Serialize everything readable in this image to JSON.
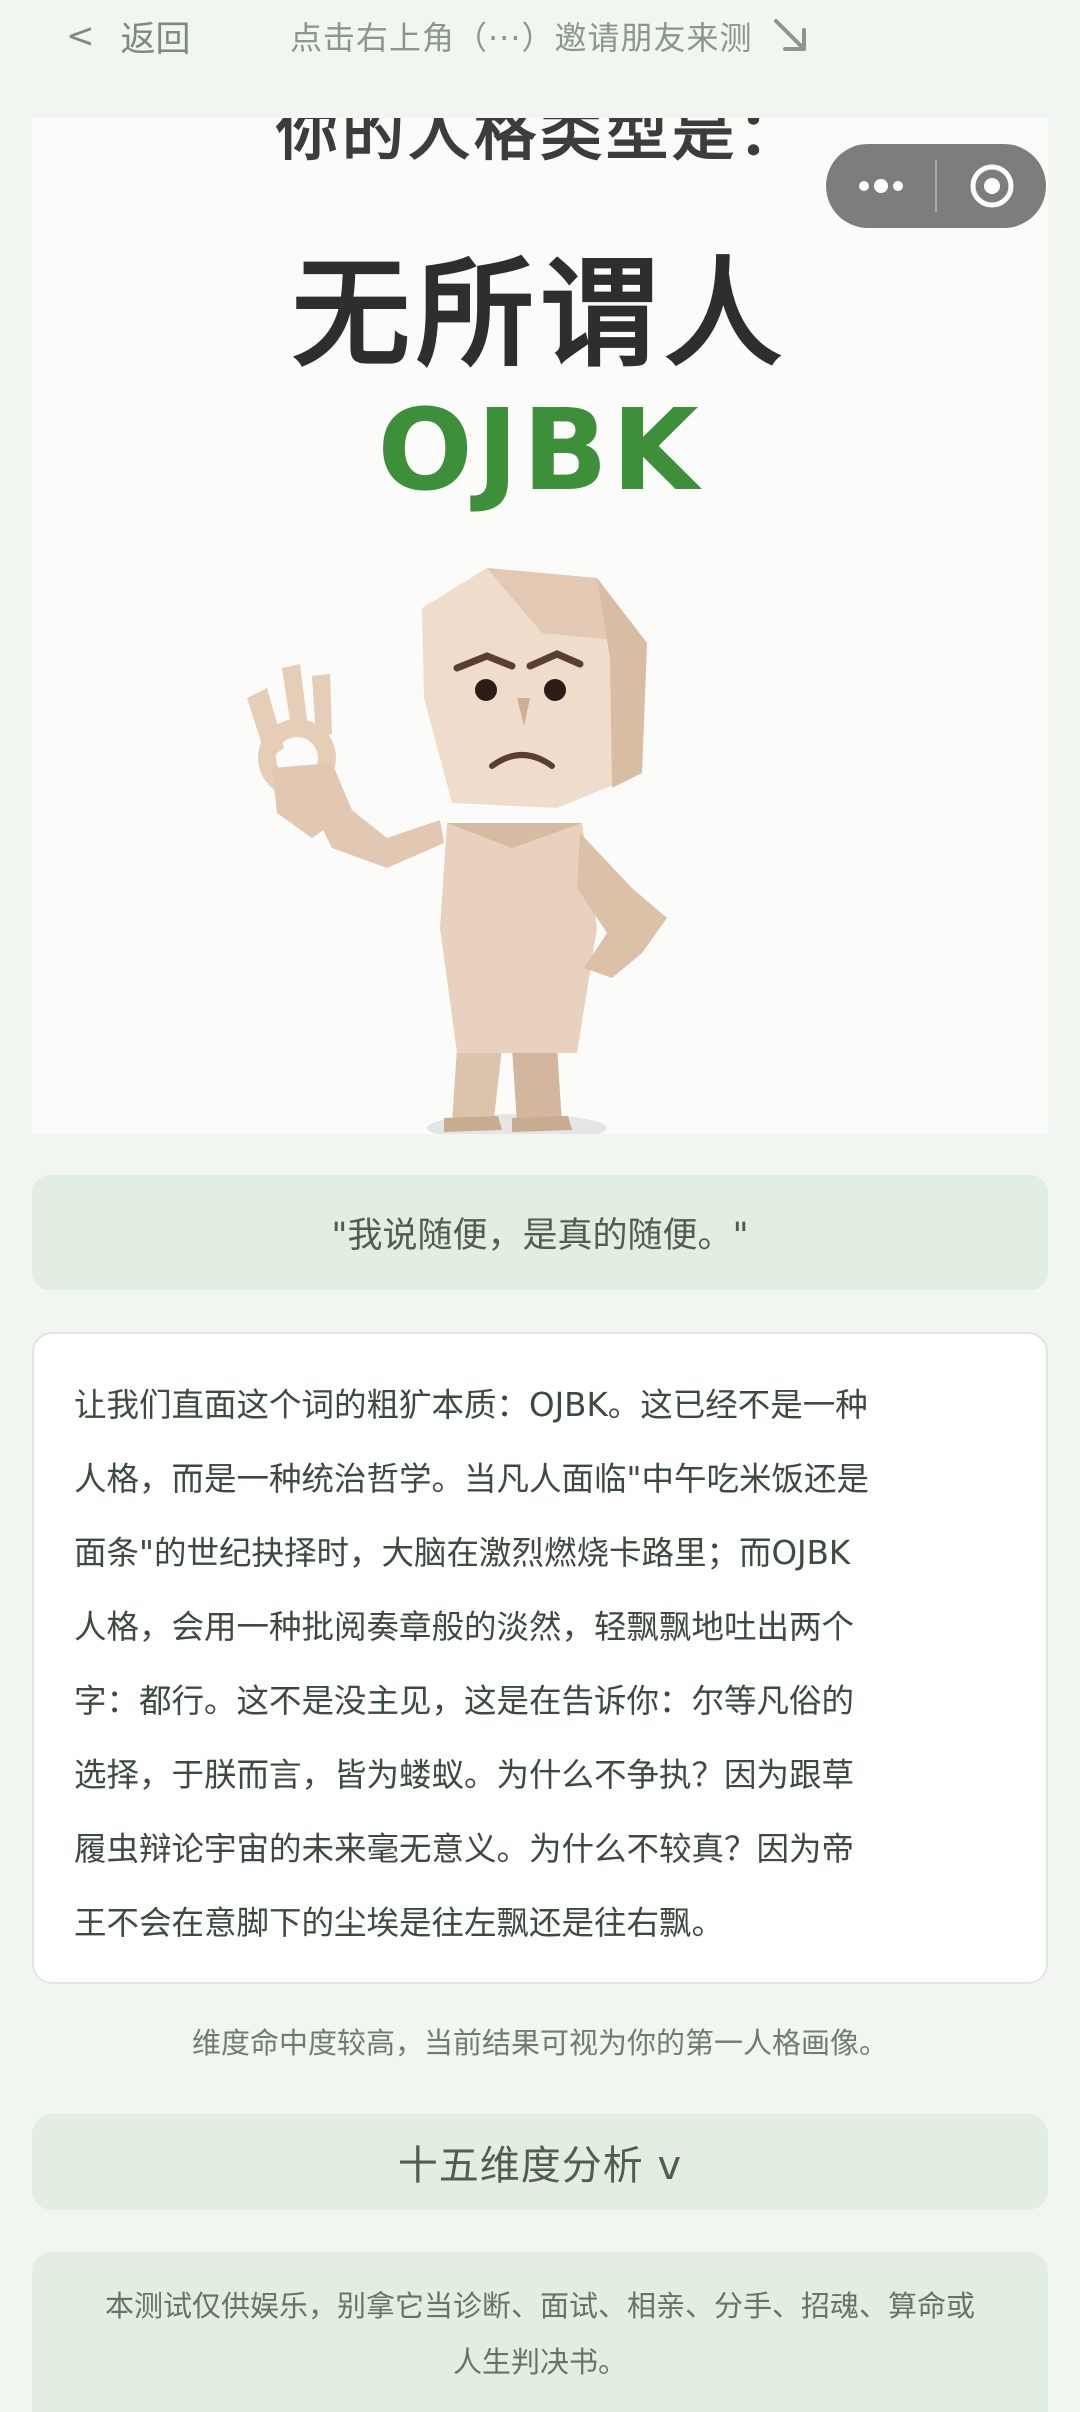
{
  "topbar": {
    "back_chevron": "<",
    "back_label": "返回",
    "hint": "点击右上角（···）邀请朋友来测",
    "hint_arrow_icon": "arrow-down-right-icon"
  },
  "hero": {
    "cut_title": "你的人格类型是：",
    "type_name": "无所谓人",
    "type_code": "OJBK"
  },
  "capsule": {
    "more_icon": "more-dots-icon",
    "close_icon": "target-circle-icon"
  },
  "quote": "\"我说随便，是真的随便。\"",
  "description_lines": [
    "让我们直面这个词的粗犷本质：OJBK。这已经不是一种",
    "人格，而是一种统治哲学。当凡人面临\"中午吃米饭还是",
    "面条\"的世纪抉择时，大脑在激烈燃烧卡路里；而OJBK",
    "人格，会用一种批阅奏章般的淡然，轻飘飘地吐出两个",
    "字：都行。这不是没主见，这是在告诉你：尔等凡俗的",
    "选择，于朕而言，皆为蝼蚁。为什么不争执？因为跟草",
    "履虫辩论宇宙的未来毫无意义。为什么不较真？因为帝",
    "王不会在意脚下的尘埃是往左飘还是往右飘。"
  ],
  "note": "维度命中度较高，当前结果可视为你的第一人格画像。",
  "dimensions_button": "十五维度分析 v",
  "disclaimer_lines": [
    "本测试仅供娱乐，别拿它当诊断、面试、相亲、分手、招魂、算命或",
    "人生判决书。"
  ],
  "colors": {
    "background": "#f1f6f1",
    "accent_green": "#3d8f3a",
    "panel_green": "#e3eee2",
    "capsule_gray": "#7d7d7d"
  }
}
